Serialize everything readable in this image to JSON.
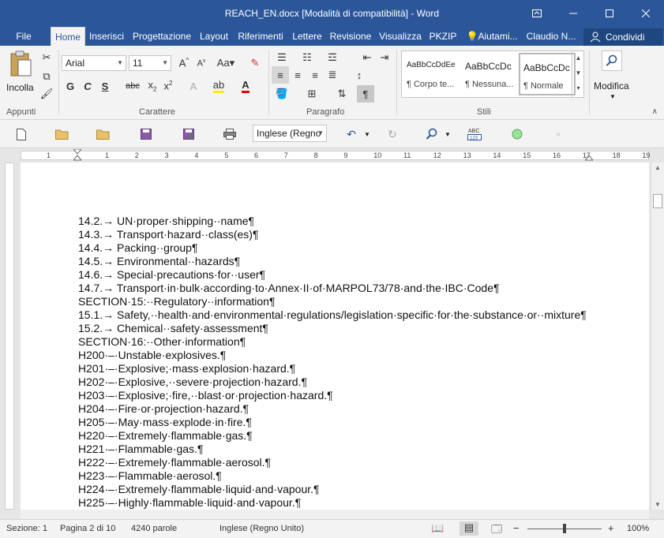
{
  "window": {
    "title": "REACH_EN.docx [Modalità di compatibilità] - Word"
  },
  "tabs": [
    {
      "label": "File"
    },
    {
      "label": "Home"
    },
    {
      "label": "Inserisci"
    },
    {
      "label": "Progettazione"
    },
    {
      "label": "Layout"
    },
    {
      "label": "Riferimenti"
    },
    {
      "label": "Lettere"
    },
    {
      "label": "Revisione"
    },
    {
      "label": "Visualizza"
    },
    {
      "label": "PKZIP"
    },
    {
      "label": "Aiutami..."
    },
    {
      "label": "Claudio N..."
    }
  ],
  "share_label": "Condividi",
  "ribbon": {
    "paste_label": "Incolla",
    "font_name": "Arial",
    "font_size": "11",
    "groups": {
      "clipboard": "Appunti",
      "font": "Carattere",
      "paragraph": "Paragrafo",
      "styles": "Stili"
    },
    "styles": [
      {
        "sample": "AaBbCcDdEe",
        "name": "¶ Corpo te..."
      },
      {
        "sample": "AaBbCcDc",
        "name": "¶ Nessuna..."
      },
      {
        "sample": "AaBbCcDc",
        "name": "¶ Normale"
      }
    ],
    "edit_label": "Modifica"
  },
  "qat": {
    "language": "Inglese (Regno"
  },
  "ruler_numbers": [
    "1",
    "1",
    "2",
    "3",
    "4",
    "5",
    "6",
    "7",
    "8",
    "9",
    "10",
    "11",
    "12",
    "13",
    "14",
    "15",
    "16",
    "17",
    "18",
    "19"
  ],
  "document": {
    "lines": [
      "14.2.→ UN·proper·shipping··name¶",
      "14.3.→ Transport·hazard··class(es)¶",
      "14.4.→ Packing··group¶",
      "14.5.→ Environmental··hazards¶",
      "14.6.→ Special·precautions·for··user¶",
      "14.7.→ Transport·in·bulk·according·to·Annex·II·of·MARPOL73/78·and·the·IBC·Code¶",
      "SECTION·15:··Regulatory··information¶",
      "15.1.→ Safety,··health·and·environmental·regulations/legislation·specific·for·the·substance·or··mixture¶",
      "15.2.→ Chemical··safety·assessment¶",
      "SECTION·16:··Other·information¶",
      "H200·–·Unstable·explosives.¶",
      "H201·–·Explosive;·mass·explosion·hazard.¶",
      "H202·–·Explosive,··severe·projection·hazard.¶",
      "H203·–·Explosive;·fire,··blast·or·projection·hazard.¶",
      "H204·–·Fire·or·projection·hazard.¶",
      "H205·–·May·mass·explode·in·fire.¶",
      "H220·–·Extremely·flammable·gas.¶",
      "H221·–·Flammable·gas.¶",
      "H222·–·Extremely·flammable·aerosol.¶",
      "H223·–·Flammable·aerosol.¶",
      "H224·–·Extremely·flammable·liquid·and·vapour.¶",
      "H225·–·Highly·flammable·liquid·and·vapour.¶"
    ]
  },
  "status": {
    "section": "Sezione: 1",
    "page": "Pagina 2 di 10",
    "words": "4240 parole",
    "language": "Inglese (Regno Unito)",
    "zoom": "100%"
  }
}
